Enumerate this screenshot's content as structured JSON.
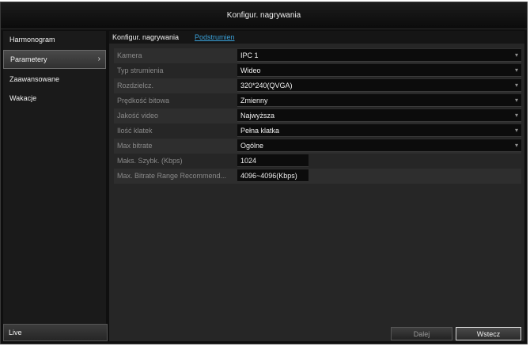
{
  "window": {
    "title": "Konfigur. nagrywania"
  },
  "sidebar": {
    "items": [
      {
        "label": "Harmonogram"
      },
      {
        "label": "Parametery",
        "chevron": "›"
      },
      {
        "label": "Zaawansowane"
      },
      {
        "label": "Wakacje"
      }
    ],
    "live_label": "Live"
  },
  "tabs": [
    {
      "label": "Konfigur. nagrywania"
    },
    {
      "label": "Podstrumien"
    }
  ],
  "form": {
    "rows": [
      {
        "label": "Kamera",
        "value": "IPC 1",
        "dropdown": true
      },
      {
        "label": "Typ strumienia",
        "value": "Wideo",
        "dropdown": true
      },
      {
        "label": "Rozdzielcz.",
        "value": "320*240(QVGA)",
        "dropdown": true
      },
      {
        "label": "Prędkość bitowa",
        "value": "Zmienny",
        "dropdown": true
      },
      {
        "label": "Jakość video",
        "value": "Najwyższa",
        "dropdown": true
      },
      {
        "label": "Ilość klatek",
        "value": "Pełna klatka",
        "dropdown": true
      },
      {
        "label": "Max bitrate",
        "value": "Ogólne",
        "dropdown": true
      },
      {
        "label": "Maks. Szybk. (Kbps)",
        "value": "1024",
        "dropdown": false
      },
      {
        "label": "Max. Bitrate Range Recommend...",
        "value": "4096~4096(Kbps)",
        "dropdown": false
      }
    ],
    "arrow_glyph": "▾"
  },
  "buttons": {
    "next_label": "Dalej",
    "exit_label": "Wstecz"
  }
}
